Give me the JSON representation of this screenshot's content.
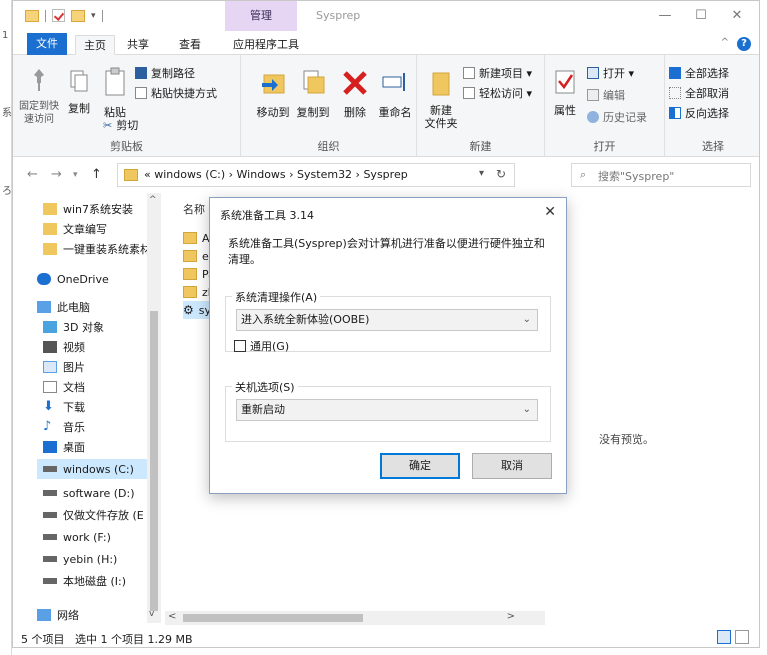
{
  "window": {
    "title": "Sysprep",
    "context_tab": "管理",
    "controls": {
      "minimize": "—",
      "maximize": "☐",
      "close": "✕"
    }
  },
  "background_window": {
    "fragments": [
      "1",
      "系",
      "ろ"
    ]
  },
  "ribbon_tabs": [
    "文件",
    "主页",
    "共享",
    "查看",
    "应用程序工具"
  ],
  "ribbon": {
    "clipboard": {
      "label": "剪贴板",
      "pin": "固定到快\n速访问",
      "copy": "复制",
      "paste": "粘贴",
      "copy_path": "复制路径",
      "paste_shortcut": "粘贴快捷方式",
      "cut": "剪切"
    },
    "organize": {
      "label": "组织",
      "move_to": "移动到",
      "copy_to": "复制到",
      "delete": "删除",
      "rename": "重命名"
    },
    "new": {
      "label": "新建",
      "new_folder": "新建\n文件夹",
      "new_item": "新建项目 ▾",
      "easy_access": "轻松访问 ▾"
    },
    "open": {
      "label": "打开",
      "properties": "属性",
      "open": "打开 ▾",
      "edit": "编辑",
      "history": "历史记录"
    },
    "select": {
      "label": "选择",
      "select_all": "全部选择",
      "select_none": "全部取消",
      "invert": "反向选择"
    }
  },
  "address": {
    "path": "«  windows (C:)  ›  Windows  ›  System32  ›  Sysprep",
    "search_placeholder": "搜索\"Sysprep\""
  },
  "nav_pane": [
    {
      "label": "win7系统安装",
      "icon": "folder-icon"
    },
    {
      "label": "文章编写",
      "icon": "folder-icon"
    },
    {
      "label": "一键重装系统素材",
      "icon": "folder-icon"
    },
    {
      "label": "OneDrive",
      "icon": "cloud-icon"
    },
    {
      "label": "此电脑",
      "icon": "computer-icon"
    },
    {
      "label": "3D 对象",
      "icon": "cube-icon"
    },
    {
      "label": "视频",
      "icon": "video-icon"
    },
    {
      "label": "图片",
      "icon": "picture-icon"
    },
    {
      "label": "文档",
      "icon": "document-icon"
    },
    {
      "label": "下载",
      "icon": "download-icon"
    },
    {
      "label": "音乐",
      "icon": "music-icon"
    },
    {
      "label": "桌面",
      "icon": "desktop-icon"
    },
    {
      "label": "windows (C:)",
      "icon": "drive-icon"
    },
    {
      "label": "software (D:)",
      "icon": "drive-icon"
    },
    {
      "label": "仅做文件存放 (E",
      "icon": "drive-icon"
    },
    {
      "label": "work (F:)",
      "icon": "drive-icon"
    },
    {
      "label": "yebin (H:)",
      "icon": "drive-icon"
    },
    {
      "label": "本地磁盘 (I:)",
      "icon": "drive-icon"
    },
    {
      "label": "网络",
      "icon": "network-icon"
    }
  ],
  "file_pane": {
    "column_name": "名称",
    "files": [
      {
        "name": "Ac"
      },
      {
        "name": "en"
      },
      {
        "name": "Pa"
      },
      {
        "name": "zh"
      },
      {
        "name": "sy"
      }
    ],
    "preview_text": "没有预览。"
  },
  "status": {
    "items": "5 个项目",
    "selected": "选中 1 个项目  1.29 MB"
  },
  "dialog": {
    "title": "系统准备工具 3.14",
    "close": "✕",
    "description": "系统准备工具(Sysprep)会对计算机进行准备以便进行硬件独立和清理。",
    "cleanup_label": "系统清理操作(A)",
    "cleanup_value": "进入系统全新体验(OOBE)",
    "generalize_label": "通用(G)",
    "generalize_checked": false,
    "shutdown_label": "关机选项(S)",
    "shutdown_value": "重新启动",
    "ok": "确定",
    "cancel": "取消"
  },
  "colors": {
    "accent": "#1a6fd1",
    "context_tab": "#e7d6f3",
    "selection": "#cce8ff",
    "folder": "#f0c75e"
  }
}
